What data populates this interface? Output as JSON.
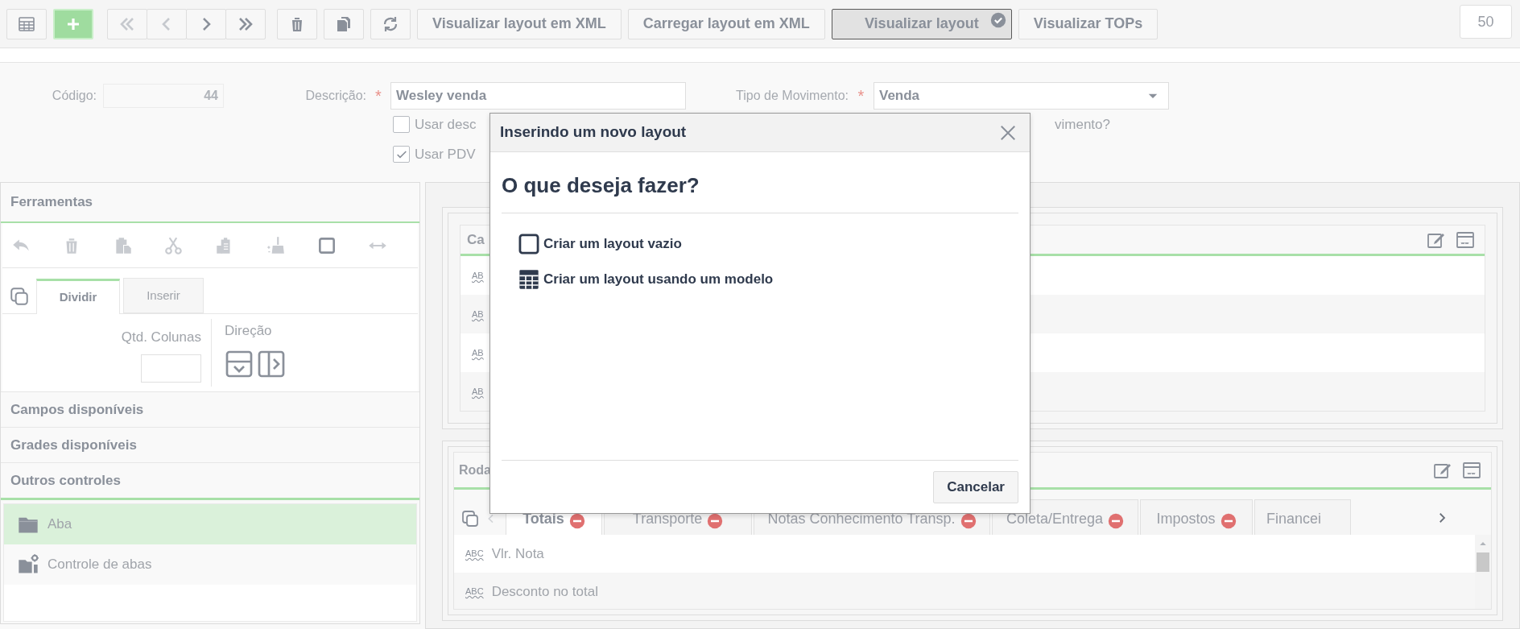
{
  "toolbar": {
    "buttons": [
      {
        "kind": "icon",
        "disabled": false
      },
      {
        "kind": "primary",
        "disabled": false
      },
      {
        "kind": "icon",
        "disabled": true
      },
      {
        "kind": "icon",
        "disabled": true
      },
      {
        "kind": "icon",
        "disabled": false
      },
      {
        "kind": "icon",
        "disabled": false
      },
      {
        "kind": "icon",
        "disabled": false
      },
      {
        "kind": "icon",
        "disabled": false
      },
      {
        "kind": "icon",
        "disabled": false
      },
      {
        "kind": "text",
        "label": "Visualizar layout em XML",
        "selected": false
      },
      {
        "kind": "text",
        "label": "Carregar layout em XML",
        "selected": false
      },
      {
        "kind": "text",
        "label": "Visualizar layout",
        "selected": true
      },
      {
        "kind": "text",
        "label": "Visualizar TOPs",
        "selected": false
      }
    ],
    "counter": "50"
  },
  "form": {
    "codigo": {
      "label": "Código:",
      "value": "44"
    },
    "descricao": {
      "label": "Descrição:",
      "required_mark": "*",
      "value": "Wesley venda"
    },
    "tipo_movimento": {
      "label": "Tipo de Movimento:",
      "required_mark": "*",
      "value": "Venda"
    },
    "checkboxes": [
      {
        "label": "Usar desc",
        "checked": false
      },
      {
        "label": "Usar PDV",
        "checked": true
      }
    ],
    "trailing_text": "vimento?"
  },
  "left_panel": {
    "tools_header": "Ferramentas",
    "tools": [
      {
        "disabled": true
      },
      {
        "disabled": true
      },
      {
        "disabled": true
      },
      {
        "disabled": true
      },
      {
        "disabled": true
      },
      {
        "disabled": true
      },
      {
        "disabled": false
      },
      {
        "disabled": true
      }
    ],
    "tabs": [
      {
        "label": "Dividir",
        "selected": true
      },
      {
        "label": "Inserir",
        "selected": false
      }
    ],
    "columns_label": "Qtd. Colunas",
    "direction_label": "Direção",
    "sections": [
      "Campos disponíveis",
      "Grades disponíveis",
      "Outros controles"
    ],
    "controls": [
      {
        "label": "Aba",
        "selected": true
      },
      {
        "label": "Controle de abas",
        "selected": false
      }
    ]
  },
  "canvas": {
    "top_section": {
      "title": "Ca",
      "rows": [
        "AB",
        "AB",
        "AB",
        "AB"
      ]
    },
    "bottom_section": {
      "title": "Roda",
      "tabs": [
        {
          "label": "Totais",
          "selected": true,
          "removable": true
        },
        {
          "label": "Transporte",
          "selected": false,
          "removable": true
        },
        {
          "label": "Notas Conhecimento Transp.",
          "selected": false,
          "removable": true
        },
        {
          "label": "Coleta/Entrega",
          "selected": false,
          "removable": true
        },
        {
          "label": "Impostos",
          "selected": false,
          "removable": true
        },
        {
          "label": "Financei",
          "selected": false,
          "removable": false
        }
      ],
      "rows": [
        {
          "icon_text": "ABC",
          "label": "Vlr. Nota"
        },
        {
          "icon_text": "ABC",
          "label": "Desconto no total"
        }
      ]
    }
  },
  "dialog": {
    "title": "Inserindo um novo layout",
    "heading": "O que deseja fazer?",
    "options": [
      {
        "kind": "empty",
        "label": "Criar um layout vazio"
      },
      {
        "kind": "template",
        "label": "Criar um layout usando um modelo"
      }
    ],
    "buttons": [
      "Cancelar"
    ]
  }
}
